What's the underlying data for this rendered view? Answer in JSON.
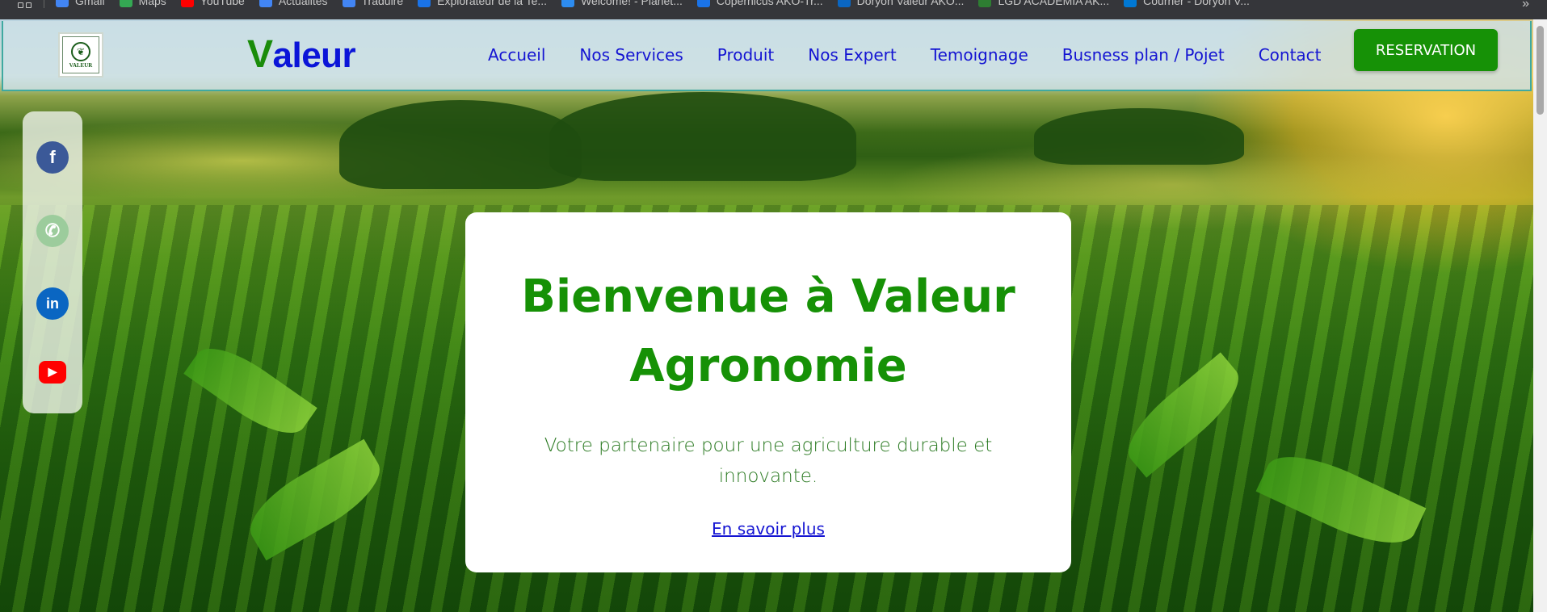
{
  "bookmarks": [
    {
      "label": "Gmail",
      "color": "#4285f4"
    },
    {
      "label": "Maps",
      "color": "#34a853"
    },
    {
      "label": "YouTube",
      "color": "#ff0000"
    },
    {
      "label": "Actualités",
      "color": "#4285f4"
    },
    {
      "label": "Traduire",
      "color": "#4285f4"
    },
    {
      "label": "Explorateur de la Te...",
      "color": "#1a73e8"
    },
    {
      "label": "Welcome! - Planet...",
      "color": "#2d8cf0"
    },
    {
      "label": "Copernicus AKO-Tr...",
      "color": "#1a73e8"
    },
    {
      "label": "Doryon Valeur AKO...",
      "color": "#0a66c2"
    },
    {
      "label": "LGD ACADEMIA AK...",
      "color": "#2e7d32"
    },
    {
      "label": "Courrier - Doryon V...",
      "color": "#0078d4"
    }
  ],
  "brand": {
    "first_letter": "V",
    "rest": "aleur",
    "logo_text": "VALEUR"
  },
  "nav": {
    "items": [
      "Accueil",
      "Nos Services",
      "Produit",
      "Nos Expert",
      "Temoignage",
      "Busness plan / Pojet",
      "Contact"
    ],
    "cta": "RESERVATION"
  },
  "social": [
    {
      "name": "facebook",
      "glyph": "f",
      "bg": "#3b5998",
      "fg": "#ffffff"
    },
    {
      "name": "whatsapp",
      "glyph": "✆",
      "bg": "#9ccc9c",
      "fg": "#ffffff"
    },
    {
      "name": "linkedin",
      "glyph": "in",
      "bg": "#0a66c2",
      "fg": "#ffffff"
    },
    {
      "name": "youtube",
      "glyph": "▶",
      "bg": "#ffffff",
      "fg": "#ff0000"
    }
  ],
  "hero": {
    "title": "Bienvenue à Valeur Agronomie",
    "subtitle": "Votre partenaire pour une agriculture durable et innovante.",
    "link": "En savoir plus"
  },
  "colors": {
    "brand_green": "#169106",
    "nav_blue": "#1414d2"
  }
}
